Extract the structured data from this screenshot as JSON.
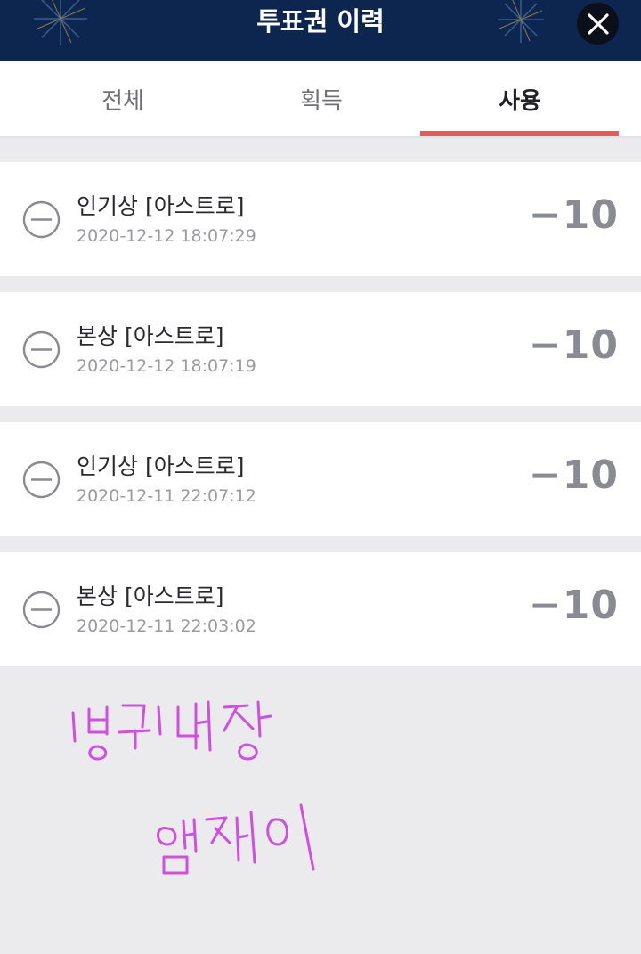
{
  "header": {
    "title": "투표권 이력",
    "close_icon": "close-icon"
  },
  "tabs": [
    {
      "label": "전체",
      "selected": false
    },
    {
      "label": "획득",
      "selected": false
    },
    {
      "label": "사용",
      "selected": true
    }
  ],
  "colors": {
    "header_bg": "#0d2650",
    "tab_indicator": "#e25b5b",
    "signature_ink": "#d04fe0"
  },
  "history": [
    {
      "icon": "minus-circle-icon",
      "title": "인기상 [아스트로]",
      "datetime": "2020-12-12 18:07:29",
      "amount": "−10"
    },
    {
      "icon": "minus-circle-icon",
      "title": "본상 [아스트로]",
      "datetime": "2020-12-12 18:07:19",
      "amount": "−10"
    },
    {
      "icon": "minus-circle-icon",
      "title": "인기상 [아스트로]",
      "datetime": "2020-12-11 22:07:12",
      "amount": "−10"
    },
    {
      "icon": "minus-circle-icon",
      "title": "본상 [아스트로]",
      "datetime": "2020-12-11 22:03:02",
      "amount": "−10"
    }
  ],
  "handwriting": {
    "line1": "빙구대장",
    "line2": "엠제이"
  }
}
